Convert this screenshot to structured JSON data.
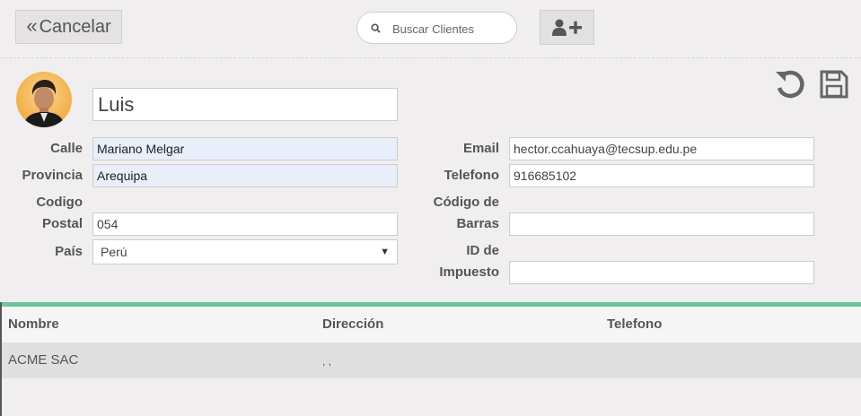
{
  "header": {
    "cancel_label": "Cancelar",
    "search_placeholder": "Buscar Clientes"
  },
  "customer": {
    "name": "Luis",
    "calle_label": "Calle",
    "calle": "Mariano Melgar",
    "provincia_label": "Provincia",
    "provincia": "Arequipa",
    "codigo_postal_label_1": "Codigo",
    "codigo_postal_label_2": "Postal",
    "codigo_postal": "054",
    "pais_label": "País",
    "pais": "Perú",
    "email_label": "Email",
    "email": "hector.ccahuaya@tecsup.edu.pe",
    "telefono_label": "Telefono",
    "telefono": "916685102",
    "barcode_label_1": "Código de",
    "barcode_label_2": "Barras",
    "barcode": "",
    "tax_label_1": "ID de",
    "tax_label_2": "Impuesto",
    "tax_id": ""
  },
  "table": {
    "columns": [
      "Nombre",
      "Dirección",
      "Telefono"
    ],
    "rows": [
      {
        "nombre": "ACME SAC",
        "direccion": ", ,",
        "telefono": ""
      }
    ]
  },
  "colors": {
    "accent_green": "#6ac59a",
    "autofill_blue": "#e8effa"
  },
  "icons": [
    "chevrons-left-icon",
    "search-icon",
    "user-plus-icon",
    "undo-icon",
    "save-icon"
  ]
}
